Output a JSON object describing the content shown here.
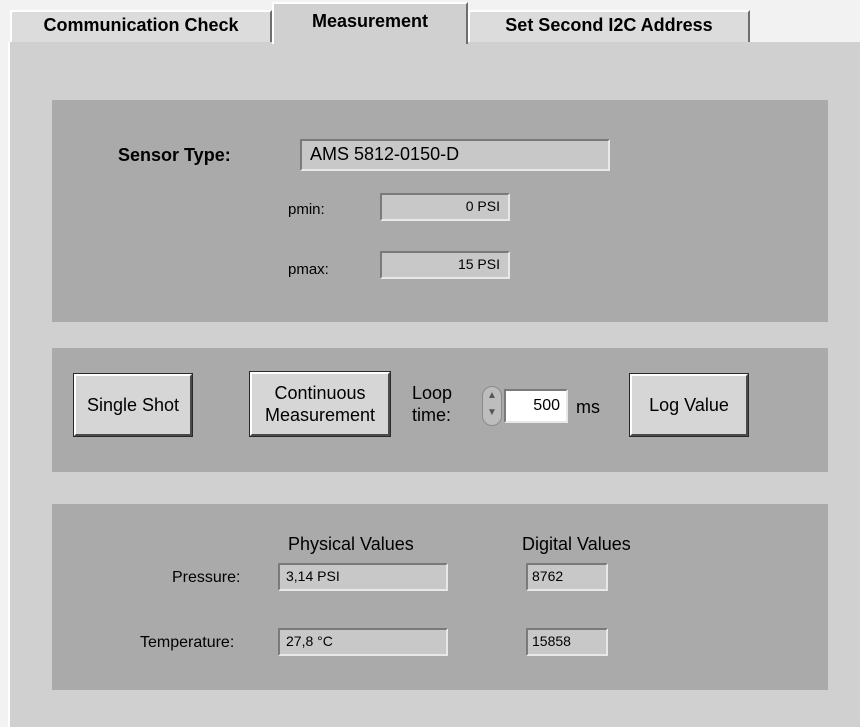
{
  "tabs": {
    "communication_check": "Communication Check",
    "measurement": "Measurement",
    "set_second_i2c": "Set Second I2C Address"
  },
  "sensor": {
    "type_label": "Sensor Type:",
    "type_value": "AMS 5812-0150-D",
    "pmin_label": "pmin:",
    "pmin_value": "0 PSI",
    "pmax_label": "pmax:",
    "pmax_value": "15 PSI"
  },
  "controls": {
    "single_shot": "Single Shot",
    "continuous_line1": "Continuous",
    "continuous_line2": "Measurement",
    "loop_label_line1": "Loop",
    "loop_label_line2": "time:",
    "loop_value": "500",
    "loop_unit": "ms",
    "log_value": "Log Value"
  },
  "values": {
    "physical_header": "Physical Values",
    "digital_header": "Digital Values",
    "pressure_label": "Pressure:",
    "pressure_physical": "3,14 PSI",
    "pressure_digital": "8762",
    "temperature_label": "Temperature:",
    "temperature_physical": "27,8 °C",
    "temperature_digital": "15858"
  }
}
